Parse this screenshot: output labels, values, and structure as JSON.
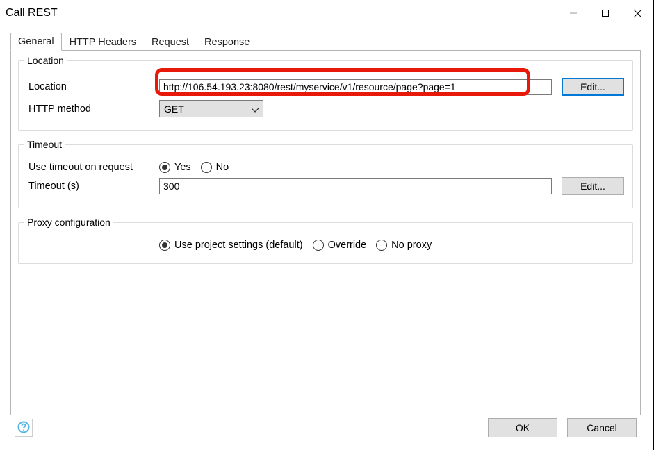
{
  "window": {
    "title": "Call REST"
  },
  "tabs": [
    {
      "label": "General"
    },
    {
      "label": "HTTP Headers"
    },
    {
      "label": "Request"
    },
    {
      "label": "Response"
    }
  ],
  "location_group": {
    "title": "Location",
    "location_label": "Location",
    "location_value": "http://106.54.193.23:8080/rest/myservice/v1/resource/page?page=1",
    "edit_label": "Edit...",
    "method_label": "HTTP method",
    "method_value": "GET"
  },
  "timeout_group": {
    "title": "Timeout",
    "use_timeout_label": "Use timeout on request",
    "yes_label": "Yes",
    "no_label": "No",
    "use_timeout_value": "yes",
    "timeout_label": "Timeout (s)",
    "timeout_value": "300",
    "edit_label": "Edit..."
  },
  "proxy_group": {
    "title": "Proxy configuration",
    "default_label": "Use project settings (default)",
    "override_label": "Override",
    "noproxy_label": "No proxy",
    "value": "default"
  },
  "footer": {
    "ok_label": "OK",
    "cancel_label": "Cancel"
  }
}
